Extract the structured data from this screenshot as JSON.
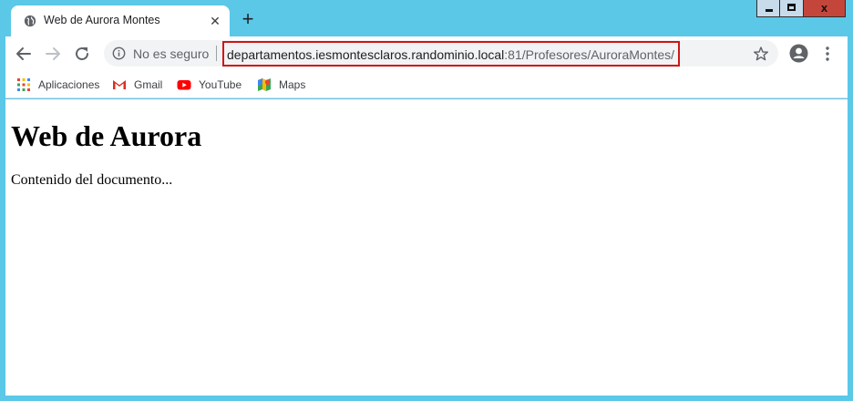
{
  "tab": {
    "title": "Web de Aurora Montes",
    "close_glyph": "✕",
    "new_tab_glyph": "+"
  },
  "window": {
    "min_icon": "minimize-icon",
    "max_icon": "maximize-icon",
    "close_glyph": "x"
  },
  "toolbar": {
    "security_label": "No es seguro",
    "url_host": "departamentos.iesmontesclaros.randominio.local",
    "url_rest": ":81/Profesores/AuroraMontes/",
    "highlight_color": "#d11515"
  },
  "bookmarks": [
    {
      "label": "Aplicaciones",
      "icon": "apps-grid-icon"
    },
    {
      "label": "Gmail",
      "icon": "gmail-icon"
    },
    {
      "label": "YouTube",
      "icon": "youtube-icon"
    },
    {
      "label": "Maps",
      "icon": "maps-icon"
    }
  ],
  "page": {
    "heading": "Web de Aurora",
    "body": "Contenido del documento..."
  },
  "colors": {
    "frame": "#5bc8e8",
    "window_close": "#c4463a",
    "youtube": "#ff0000",
    "gmail": "#d93025"
  }
}
